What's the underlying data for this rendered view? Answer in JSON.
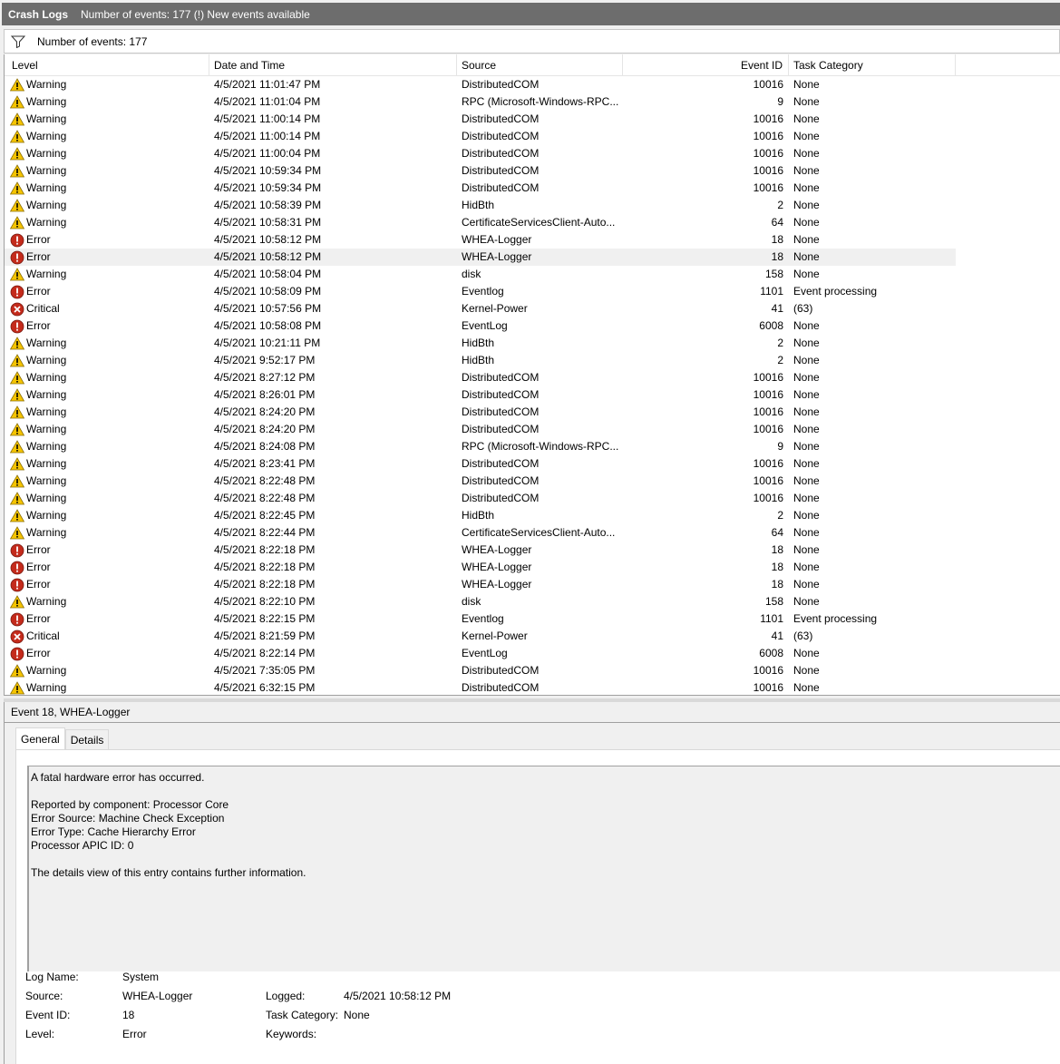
{
  "title_bar": {
    "title": "Crash Logs",
    "info": "Number of events: 177 (!) New events available"
  },
  "filter_bar": {
    "icon": "filter-icon",
    "count_text": "Number of events: 177"
  },
  "columns": {
    "level": "Level",
    "date": "Date and Time",
    "source": "Source",
    "event_id": "Event ID",
    "task": "Task Category"
  },
  "colors": {
    "warning": "#f5c400",
    "error": "#c42b1c",
    "critical": "#c42b1c",
    "title_bg": "#6d6d6d",
    "selected_row": "#f0f0f0"
  },
  "rows": [
    {
      "level": "Warning",
      "icon": "warning-icon",
      "date": "4/5/2021 11:01:47 PM",
      "source": "DistributedCOM",
      "event_id": "10016",
      "task": "None"
    },
    {
      "level": "Warning",
      "icon": "warning-icon",
      "date": "4/5/2021 11:01:04 PM",
      "source": "RPC (Microsoft-Windows-RPC...",
      "event_id": "9",
      "task": "None"
    },
    {
      "level": "Warning",
      "icon": "warning-icon",
      "date": "4/5/2021 11:00:14 PM",
      "source": "DistributedCOM",
      "event_id": "10016",
      "task": "None"
    },
    {
      "level": "Warning",
      "icon": "warning-icon",
      "date": "4/5/2021 11:00:14 PM",
      "source": "DistributedCOM",
      "event_id": "10016",
      "task": "None"
    },
    {
      "level": "Warning",
      "icon": "warning-icon",
      "date": "4/5/2021 11:00:04 PM",
      "source": "DistributedCOM",
      "event_id": "10016",
      "task": "None"
    },
    {
      "level": "Warning",
      "icon": "warning-icon",
      "date": "4/5/2021 10:59:34 PM",
      "source": "DistributedCOM",
      "event_id": "10016",
      "task": "None"
    },
    {
      "level": "Warning",
      "icon": "warning-icon",
      "date": "4/5/2021 10:59:34 PM",
      "source": "DistributedCOM",
      "event_id": "10016",
      "task": "None"
    },
    {
      "level": "Warning",
      "icon": "warning-icon",
      "date": "4/5/2021 10:58:39 PM",
      "source": "HidBth",
      "event_id": "2",
      "task": "None"
    },
    {
      "level": "Warning",
      "icon": "warning-icon",
      "date": "4/5/2021 10:58:31 PM",
      "source": "CertificateServicesClient-Auto...",
      "event_id": "64",
      "task": "None"
    },
    {
      "level": "Error",
      "icon": "error-icon",
      "date": "4/5/2021 10:58:12 PM",
      "source": "WHEA-Logger",
      "event_id": "18",
      "task": "None"
    },
    {
      "level": "Error",
      "icon": "error-icon",
      "date": "4/5/2021 10:58:12 PM",
      "source": "WHEA-Logger",
      "event_id": "18",
      "task": "None",
      "selected": true
    },
    {
      "level": "Warning",
      "icon": "warning-icon",
      "date": "4/5/2021 10:58:04 PM",
      "source": "disk",
      "event_id": "158",
      "task": "None"
    },
    {
      "level": "Error",
      "icon": "error-icon",
      "date": "4/5/2021 10:58:09 PM",
      "source": "Eventlog",
      "event_id": "1101",
      "task": "Event processing"
    },
    {
      "level": "Critical",
      "icon": "critical-icon",
      "date": "4/5/2021 10:57:56 PM",
      "source": "Kernel-Power",
      "event_id": "41",
      "task": "(63)"
    },
    {
      "level": "Error",
      "icon": "error-icon",
      "date": "4/5/2021 10:58:08 PM",
      "source": "EventLog",
      "event_id": "6008",
      "task": "None"
    },
    {
      "level": "Warning",
      "icon": "warning-icon",
      "date": "4/5/2021 10:21:11 PM",
      "source": "HidBth",
      "event_id": "2",
      "task": "None"
    },
    {
      "level": "Warning",
      "icon": "warning-icon",
      "date": "4/5/2021 9:52:17 PM",
      "source": "HidBth",
      "event_id": "2",
      "task": "None"
    },
    {
      "level": "Warning",
      "icon": "warning-icon",
      "date": "4/5/2021 8:27:12 PM",
      "source": "DistributedCOM",
      "event_id": "10016",
      "task": "None"
    },
    {
      "level": "Warning",
      "icon": "warning-icon",
      "date": "4/5/2021 8:26:01 PM",
      "source": "DistributedCOM",
      "event_id": "10016",
      "task": "None"
    },
    {
      "level": "Warning",
      "icon": "warning-icon",
      "date": "4/5/2021 8:24:20 PM",
      "source": "DistributedCOM",
      "event_id": "10016",
      "task": "None"
    },
    {
      "level": "Warning",
      "icon": "warning-icon",
      "date": "4/5/2021 8:24:20 PM",
      "source": "DistributedCOM",
      "event_id": "10016",
      "task": "None"
    },
    {
      "level": "Warning",
      "icon": "warning-icon",
      "date": "4/5/2021 8:24:08 PM",
      "source": "RPC (Microsoft-Windows-RPC...",
      "event_id": "9",
      "task": "None"
    },
    {
      "level": "Warning",
      "icon": "warning-icon",
      "date": "4/5/2021 8:23:41 PM",
      "source": "DistributedCOM",
      "event_id": "10016",
      "task": "None"
    },
    {
      "level": "Warning",
      "icon": "warning-icon",
      "date": "4/5/2021 8:22:48 PM",
      "source": "DistributedCOM",
      "event_id": "10016",
      "task": "None"
    },
    {
      "level": "Warning",
      "icon": "warning-icon",
      "date": "4/5/2021 8:22:48 PM",
      "source": "DistributedCOM",
      "event_id": "10016",
      "task": "None"
    },
    {
      "level": "Warning",
      "icon": "warning-icon",
      "date": "4/5/2021 8:22:45 PM",
      "source": "HidBth",
      "event_id": "2",
      "task": "None"
    },
    {
      "level": "Warning",
      "icon": "warning-icon",
      "date": "4/5/2021 8:22:44 PM",
      "source": "CertificateServicesClient-Auto...",
      "event_id": "64",
      "task": "None"
    },
    {
      "level": "Error",
      "icon": "error-icon",
      "date": "4/5/2021 8:22:18 PM",
      "source": "WHEA-Logger",
      "event_id": "18",
      "task": "None"
    },
    {
      "level": "Error",
      "icon": "error-icon",
      "date": "4/5/2021 8:22:18 PM",
      "source": "WHEA-Logger",
      "event_id": "18",
      "task": "None"
    },
    {
      "level": "Error",
      "icon": "error-icon",
      "date": "4/5/2021 8:22:18 PM",
      "source": "WHEA-Logger",
      "event_id": "18",
      "task": "None"
    },
    {
      "level": "Warning",
      "icon": "warning-icon",
      "date": "4/5/2021 8:22:10 PM",
      "source": "disk",
      "event_id": "158",
      "task": "None"
    },
    {
      "level": "Error",
      "icon": "error-icon",
      "date": "4/5/2021 8:22:15 PM",
      "source": "Eventlog",
      "event_id": "1101",
      "task": "Event processing"
    },
    {
      "level": "Critical",
      "icon": "critical-icon",
      "date": "4/5/2021 8:21:59 PM",
      "source": "Kernel-Power",
      "event_id": "41",
      "task": "(63)"
    },
    {
      "level": "Error",
      "icon": "error-icon",
      "date": "4/5/2021 8:22:14 PM",
      "source": "EventLog",
      "event_id": "6008",
      "task": "None"
    },
    {
      "level": "Warning",
      "icon": "warning-icon",
      "date": "4/5/2021 7:35:05 PM",
      "source": "DistributedCOM",
      "event_id": "10016",
      "task": "None"
    },
    {
      "level": "Warning",
      "icon": "warning-icon",
      "date": "4/5/2021 6:32:15 PM",
      "source": "DistributedCOM",
      "event_id": "10016",
      "task": "None"
    }
  ],
  "details": {
    "title": "Event 18, WHEA-Logger",
    "tabs": [
      "General",
      "Details"
    ],
    "message_lines": [
      "A fatal hardware error has occurred.",
      "",
      "Reported by component: Processor Core",
      "Error Source: Machine Check Exception",
      "Error Type: Cache Hierarchy Error",
      "Processor APIC ID: 0",
      "",
      "The details view of this entry contains further information."
    ],
    "properties": {
      "log_name_label": "Log Name:",
      "log_name": "System",
      "source_label": "Source:",
      "source": "WHEA-Logger",
      "logged_label": "Logged:",
      "logged": "4/5/2021 10:58:12 PM",
      "event_id_label": "Event ID:",
      "event_id": "18",
      "task_label": "Task Category:",
      "task": "None",
      "level_label": "Level:",
      "level": "Error",
      "keywords_label": "Keywords:",
      "keywords": ""
    }
  }
}
